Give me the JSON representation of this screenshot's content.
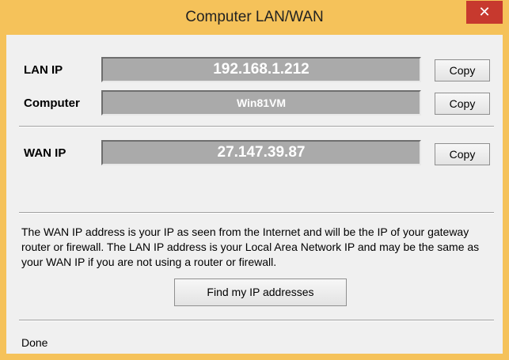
{
  "window": {
    "title": "Computer LAN/WAN",
    "close_glyph": "✕"
  },
  "rows": {
    "lan": {
      "label": "LAN IP",
      "value": "192.168.1.212",
      "copy": "Copy"
    },
    "computer": {
      "label": "Computer",
      "value": "Win81VM",
      "copy": "Copy"
    },
    "wan": {
      "label": "WAN IP",
      "value": "27.147.39.87",
      "copy": "Copy"
    }
  },
  "description": "The WAN IP address is your IP as seen from the Internet and will be the IP of your gateway router or firewall. The LAN IP address is your Local Area Network IP and may be the same as your WAN IP if you are not using a router or firewall.",
  "find_button": "Find my IP addresses",
  "status": "Done",
  "colors": {
    "title_bar": "#f5c25a",
    "close_button": "#c7392e",
    "ip_box": "#aaaaaa",
    "client_bg": "#f0f0f0"
  }
}
